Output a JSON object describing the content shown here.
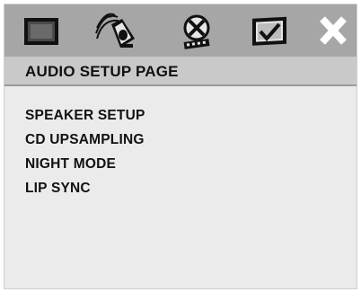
{
  "toolbar": {
    "icons": [
      "general-setup-icon",
      "audio-setup-icon",
      "video-setup-icon",
      "preference-setup-icon",
      "exit-icon"
    ]
  },
  "page": {
    "title": "AUDIO SETUP PAGE"
  },
  "menu": {
    "items": [
      {
        "label": "SPEAKER SETUP"
      },
      {
        "label": "CD UPSAMPLING"
      },
      {
        "label": "NIGHT MODE"
      },
      {
        "label": "LIP SYNC"
      }
    ]
  },
  "colors": {
    "background": "#ebebeb",
    "toolbar": "#a6a6a6",
    "header": "#c9c9c9",
    "text": "#111111"
  }
}
